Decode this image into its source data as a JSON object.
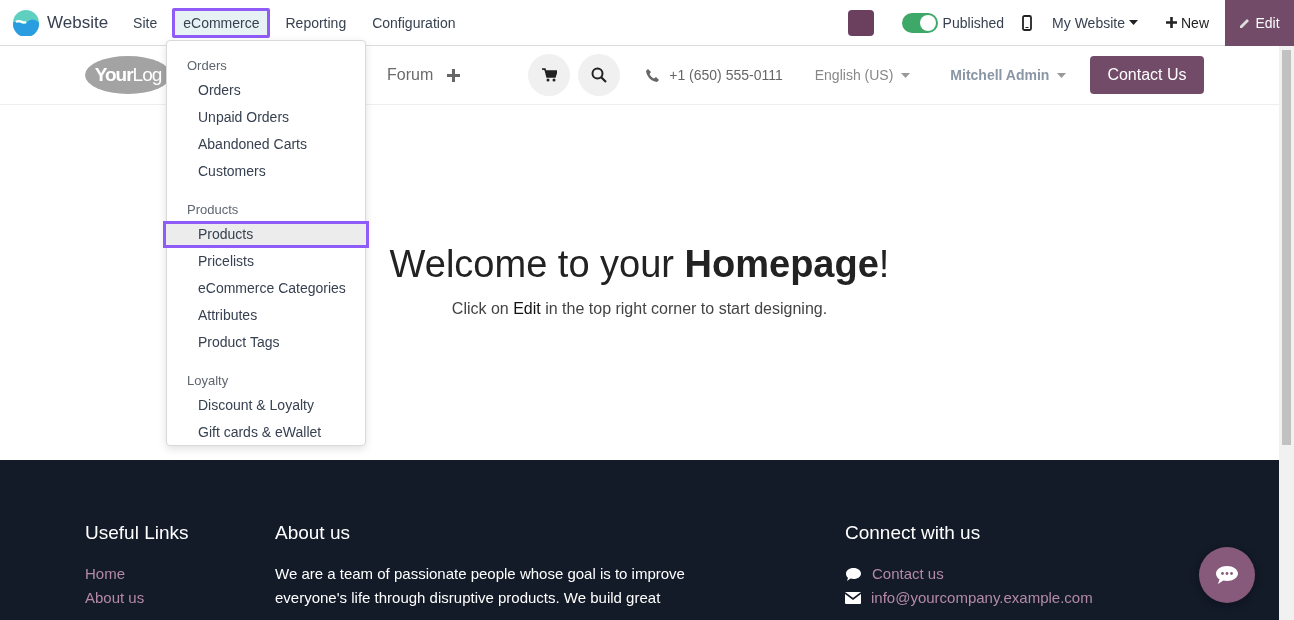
{
  "topbar": {
    "app_name": "Website",
    "menus": [
      {
        "label": "Site",
        "selected": false
      },
      {
        "label": "eCommerce",
        "selected": true
      },
      {
        "label": "Reporting",
        "selected": false
      },
      {
        "label": "Configuration",
        "selected": false
      }
    ],
    "published": {
      "label": "Published",
      "on": true
    },
    "website": "My Website",
    "new": "New",
    "edit": "Edit"
  },
  "dropdown": {
    "sections": [
      {
        "heading": "Orders",
        "items": [
          {
            "label": "Orders",
            "selected": false
          },
          {
            "label": "Unpaid Orders",
            "selected": false
          },
          {
            "label": "Abandoned Carts",
            "selected": false
          },
          {
            "label": "Customers",
            "selected": false
          }
        ]
      },
      {
        "heading": "Products",
        "items": [
          {
            "label": "Products",
            "selected": true
          },
          {
            "label": "Pricelists",
            "selected": false
          },
          {
            "label": "eCommerce Categories",
            "selected": false
          },
          {
            "label": "Attributes",
            "selected": false
          },
          {
            "label": "Product Tags",
            "selected": false
          }
        ]
      },
      {
        "heading": "Loyalty",
        "items": [
          {
            "label": "Discount & Loyalty",
            "selected": false
          },
          {
            "label": "Gift cards & eWallet",
            "selected": false
          }
        ]
      }
    ]
  },
  "header": {
    "logo": "**Your**Log",
    "nav": [
      "Forum"
    ],
    "phone": "+1 (650) 555-0111",
    "language": "English (US)",
    "user": "Mitchell Admin",
    "cta": "Contact Us"
  },
  "hero": {
    "title": "Welcome to your **Homepage**!",
    "subtitle": "Click on **Edit** in the top right corner to start designing."
  },
  "footer": {
    "useful_links": {
      "heading": "Useful Links",
      "links": [
        "Home",
        "About us"
      ]
    },
    "about": {
      "heading": "About us",
      "text": "We are a team of passionate people whose goal is to improve everyone's life through disruptive products. We build great"
    },
    "connect": {
      "heading": "Connect with us",
      "items": [
        {
          "kind": "chat",
          "label": "Contact us"
        },
        {
          "kind": "mail",
          "label": "info@yourcompany.example.com"
        }
      ]
    }
  }
}
